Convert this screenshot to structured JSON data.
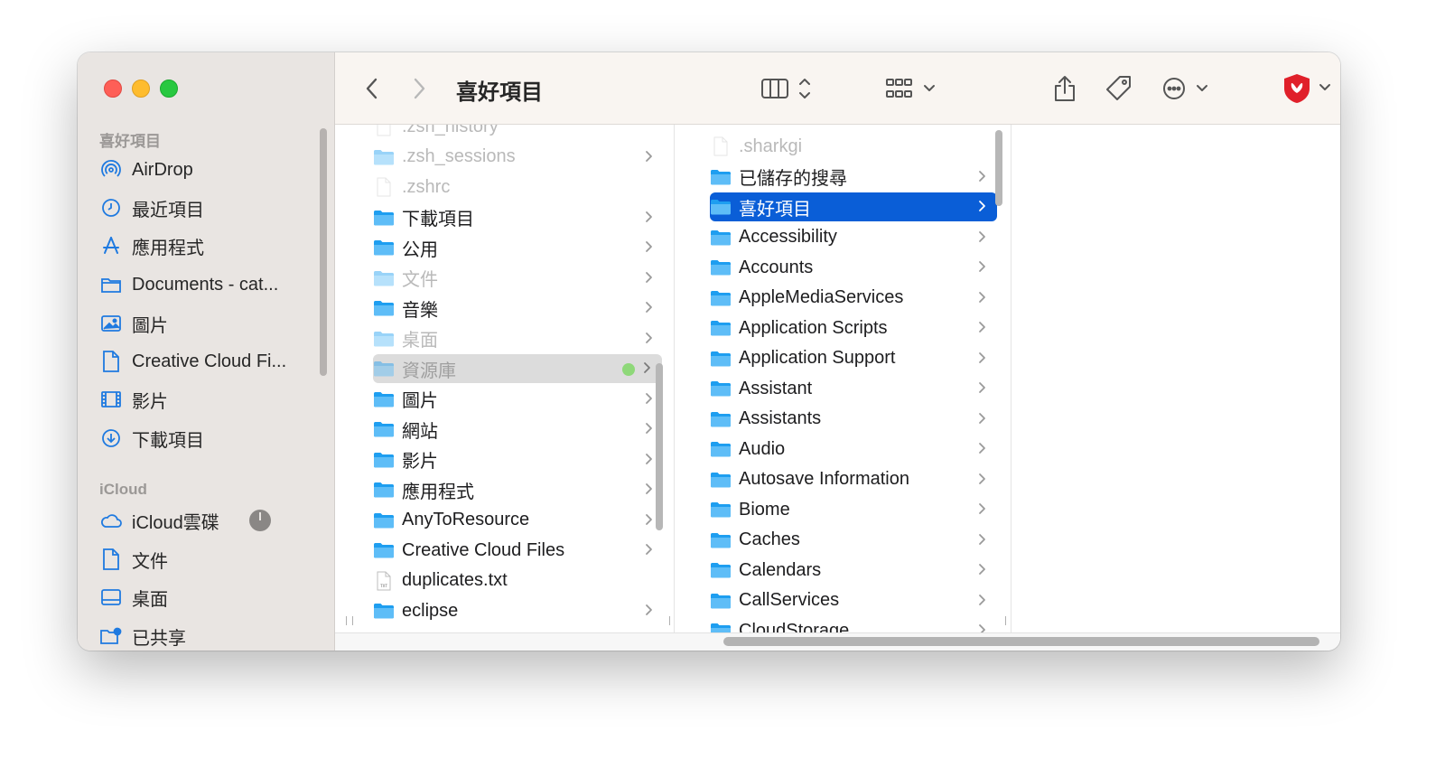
{
  "window": {
    "title": "喜好項目"
  },
  "sidebar": {
    "favorites_header": "喜好項目",
    "favorites": [
      {
        "label": "AirDrop",
        "icon": "airdrop-icon"
      },
      {
        "label": "最近項目",
        "icon": "clock-icon"
      },
      {
        "label": "應用程式",
        "icon": "applications-icon"
      },
      {
        "label": "Documents - cat...",
        "icon": "folder-icon"
      },
      {
        "label": "圖片",
        "icon": "photo-icon"
      },
      {
        "label": "Creative Cloud Fi...",
        "icon": "document-icon"
      },
      {
        "label": "影片",
        "icon": "film-icon"
      },
      {
        "label": "下載項目",
        "icon": "download-icon"
      }
    ],
    "icloud_header": "iCloud",
    "icloud": [
      {
        "label": "iCloud雲碟",
        "icon": "cloud-icon"
      },
      {
        "label": "文件",
        "icon": "document-icon"
      },
      {
        "label": "桌面",
        "icon": "desktop-icon"
      },
      {
        "label": "已共享",
        "icon": "shared-folder-icon"
      }
    ]
  },
  "toolbar": {
    "back": "back-chevron-icon",
    "forward": "forward-chevron-icon",
    "view": "column-view-icon",
    "group": "grid-group-icon",
    "share": "share-icon",
    "tag": "tag-icon",
    "more": "ellipsis-circle-icon",
    "extension": "shield-extension-icon",
    "search": "search-icon"
  },
  "column1": [
    {
      "label": ".zsh_history",
      "type": "file",
      "dim": true,
      "chevron": false
    },
    {
      "label": ".zsh_sessions",
      "type": "folder",
      "dim": true,
      "chevron": true
    },
    {
      "label": ".zshrc",
      "type": "file",
      "dim": true,
      "chevron": false
    },
    {
      "label": "下載項目",
      "type": "folder",
      "dim": false,
      "chevron": true
    },
    {
      "label": "公用",
      "type": "folder",
      "dim": false,
      "chevron": true
    },
    {
      "label": "文件",
      "type": "folder",
      "dim": true,
      "chevron": true
    },
    {
      "label": "音樂",
      "type": "folder",
      "dim": false,
      "chevron": true
    },
    {
      "label": "桌面",
      "type": "folder",
      "dim": true,
      "chevron": true
    },
    {
      "label": "資源庫",
      "type": "folder",
      "dim": true,
      "chevron": true,
      "selected": true,
      "tag_color": "#8ed879"
    },
    {
      "label": "圖片",
      "type": "folder",
      "dim": false,
      "chevron": true
    },
    {
      "label": "網站",
      "type": "folder",
      "dim": false,
      "chevron": true
    },
    {
      "label": "影片",
      "type": "folder",
      "dim": false,
      "chevron": true
    },
    {
      "label": "應用程式",
      "type": "folder",
      "dim": false,
      "chevron": true
    },
    {
      "label": "AnyToResource",
      "type": "folder",
      "dim": false,
      "chevron": true
    },
    {
      "label": "Creative Cloud Files",
      "type": "folder",
      "dim": false,
      "chevron": true
    },
    {
      "label": "duplicates.txt",
      "type": "txt",
      "dim": false,
      "chevron": false
    },
    {
      "label": "eclipse",
      "type": "folder",
      "dim": false,
      "chevron": true
    }
  ],
  "column2": [
    {
      "label": ".sharkgi",
      "type": "file",
      "dim": true,
      "chevron": false
    },
    {
      "label": "已儲存的搜尋",
      "type": "folder",
      "dim": false,
      "chevron": true
    },
    {
      "label": "喜好項目",
      "type": "folder",
      "dim": false,
      "chevron": true,
      "selected": true
    },
    {
      "label": "Accessibility",
      "type": "folder",
      "dim": false,
      "chevron": true
    },
    {
      "label": "Accounts",
      "type": "folder",
      "dim": false,
      "chevron": true
    },
    {
      "label": "AppleMediaServices",
      "type": "folder",
      "dim": false,
      "chevron": true
    },
    {
      "label": "Application Scripts",
      "type": "folder",
      "dim": false,
      "chevron": true
    },
    {
      "label": "Application Support",
      "type": "folder",
      "dim": false,
      "chevron": true
    },
    {
      "label": "Assistant",
      "type": "folder",
      "dim": false,
      "chevron": true
    },
    {
      "label": "Assistants",
      "type": "folder",
      "dim": false,
      "chevron": true
    },
    {
      "label": "Audio",
      "type": "folder",
      "dim": false,
      "chevron": true
    },
    {
      "label": "Autosave Information",
      "type": "folder",
      "dim": false,
      "chevron": true
    },
    {
      "label": "Biome",
      "type": "folder",
      "dim": false,
      "chevron": true
    },
    {
      "label": "Caches",
      "type": "folder",
      "dim": false,
      "chevron": true
    },
    {
      "label": "Calendars",
      "type": "folder",
      "dim": false,
      "chevron": true
    },
    {
      "label": "CallServices",
      "type": "folder",
      "dim": false,
      "chevron": true
    },
    {
      "label": "CloudStorage",
      "type": "folder",
      "dim": false,
      "chevron": true
    }
  ],
  "colors": {
    "accent": "#0a5ed7",
    "folder": "#1e9ef0",
    "sidebar_icon": "#1f7ae0",
    "close": "#fe5f57",
    "minimize": "#febc2e",
    "maximize": "#28c840",
    "extension": "#e0202a"
  }
}
